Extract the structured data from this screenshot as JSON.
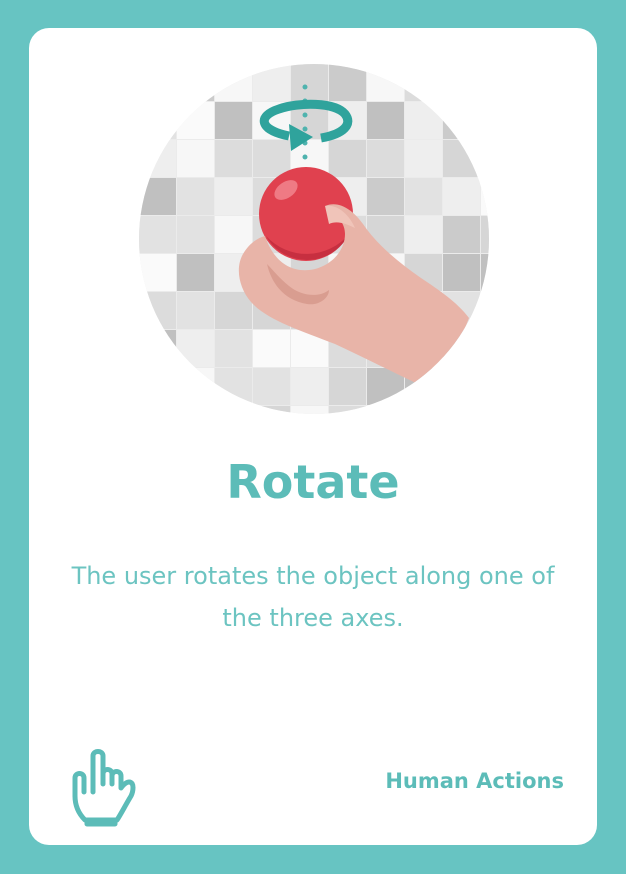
{
  "card": {
    "title": "Rotate",
    "description": "The user rotates the object along one of the three axes.",
    "category": "Human Actions"
  },
  "icons": {
    "illustration": "hand-rotating-ball-illustration",
    "category": "pointing-hand-icon"
  },
  "colors": {
    "background": "#67c4c2",
    "accent": "#5cbcb8",
    "ball": "#e0414f",
    "skin": "#e8b4a8"
  }
}
